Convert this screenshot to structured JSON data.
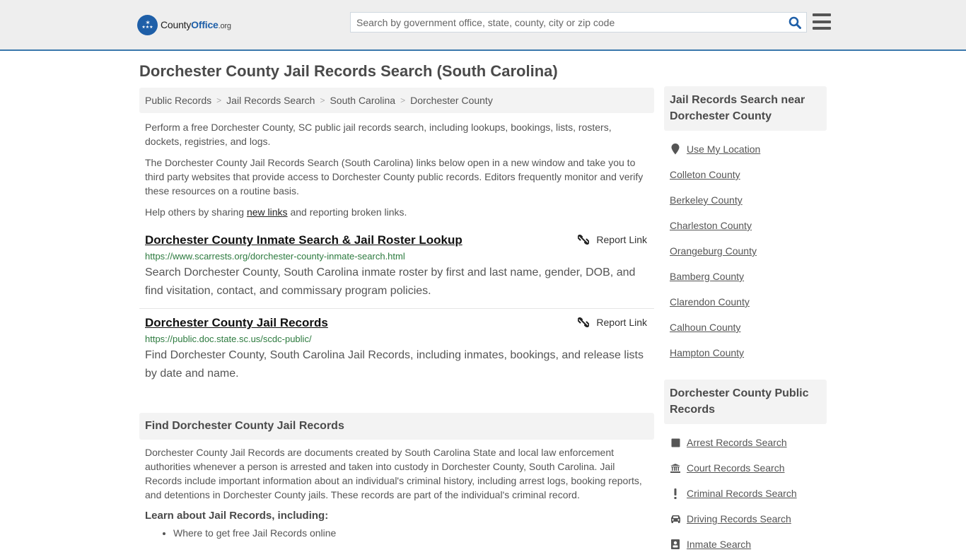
{
  "header": {
    "logo": {
      "county": "County",
      "office": "Office",
      "org": ".org"
    },
    "search": {
      "placeholder": "Search by government office, state, county, city or zip code",
      "value": ""
    },
    "icons": {
      "search": "search-icon",
      "menu": "hamburger-menu-icon"
    }
  },
  "page": {
    "title": "Dorchester County Jail Records Search (South Carolina)"
  },
  "breadcrumb": [
    {
      "label": "Public Records"
    },
    {
      "label": "Jail Records Search"
    },
    {
      "label": "South Carolina"
    },
    {
      "label": "Dorchester County"
    }
  ],
  "intro": {
    "p1": "Perform a free Dorchester County, SC public jail records search, including lookups, bookings, lists, rosters, dockets, registries, and logs.",
    "p2": "The Dorchester County Jail Records Search (South Carolina) links below open in a new window and take you to third party websites that provide access to Dorchester County public records. Editors frequently monitor and verify these resources on a routine basis.",
    "p3_before": "Help others by sharing ",
    "p3_link": "new links",
    "p3_after": " and reporting broken links."
  },
  "results": [
    {
      "title": "Dorchester County Inmate Search & Jail Roster Lookup",
      "url": "https://www.scarrests.org/dorchester-county-inmate-search.html",
      "description": "Search Dorchester County, South Carolina inmate roster by first and last name, gender, DOB, and find visitation, contact, and commissary program policies.",
      "report_label": "Report Link"
    },
    {
      "title": "Dorchester County Jail Records",
      "url": "https://public.doc.state.sc.us/scdc-public/",
      "description": "Find Dorchester County, South Carolina Jail Records, including inmates, bookings, and release lists by date and name.",
      "report_label": "Report Link"
    }
  ],
  "find_section": {
    "heading": "Find Dorchester County Jail Records",
    "body": "Dorchester County Jail Records are documents created by South Carolina State and local law enforcement authorities whenever a person is arrested and taken into custody in Dorchester County, South Carolina. Jail Records include important information about an individual's criminal history, including arrest logs, booking reports, and detentions in Dorchester County jails. These records are part of the individual's criminal record.",
    "learn_heading": "Learn about Jail Records, including:",
    "learn_items": [
      "Where to get free Jail Records online"
    ]
  },
  "sidebar": {
    "nearby": {
      "heading": "Jail Records Search near Dorchester County",
      "use_location": {
        "label": "Use My Location",
        "icon": "map-marker-icon"
      },
      "counties": [
        "Colleton County",
        "Berkeley County",
        "Charleston County",
        "Orangeburg County",
        "Bamberg County",
        "Clarendon County",
        "Calhoun County",
        "Hampton County"
      ]
    },
    "public_records": {
      "heading": "Dorchester County Public Records",
      "items": [
        {
          "label": "Arrest Records Search",
          "icon": "square-icon"
        },
        {
          "label": "Court Records Search",
          "icon": "courthouse-icon"
        },
        {
          "label": "Criminal Records Search",
          "icon": "exclamation-icon"
        },
        {
          "label": "Driving Records Search",
          "icon": "car-icon"
        },
        {
          "label": "Inmate Search",
          "icon": "inmate-icon"
        }
      ]
    }
  },
  "colors": {
    "brand_blue": "#1e5fa8",
    "header_border": "#3a78ac",
    "url_green": "#2c7a3e"
  }
}
